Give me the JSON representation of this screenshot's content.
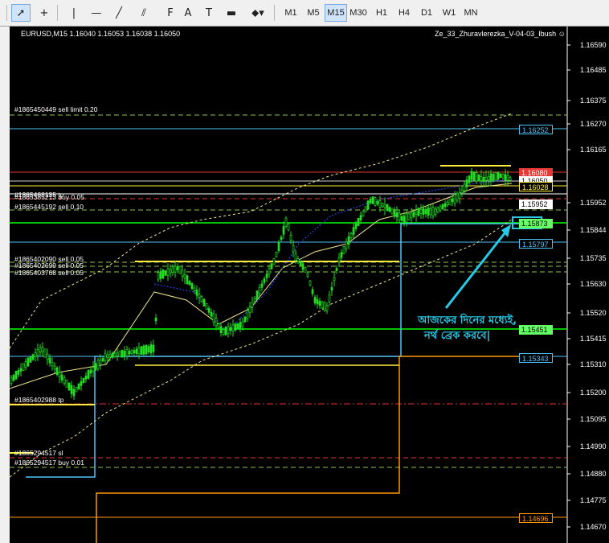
{
  "toolbar": {
    "tools": [
      {
        "name": "cursor-arrow-icon",
        "glyph": "➚"
      },
      {
        "name": "crosshair-icon",
        "glyph": "+"
      },
      {
        "name": "vertical-line-icon",
        "glyph": "|"
      },
      {
        "name": "horizontal-line-icon",
        "glyph": "—"
      },
      {
        "name": "trendline-icon",
        "glyph": "╱"
      },
      {
        "name": "channel-icon",
        "glyph": "⫽"
      },
      {
        "name": "fibonacci-icon",
        "glyph": "F"
      },
      {
        "name": "text-icon",
        "glyph": "A"
      },
      {
        "name": "text-label-icon",
        "glyph": "T"
      },
      {
        "name": "rectangle-icon",
        "glyph": "▬"
      },
      {
        "name": "arrows-dropdown-icon",
        "glyph": "⬥▾"
      }
    ],
    "timeframes": [
      "M1",
      "M5",
      "M15",
      "M30",
      "H1",
      "H4",
      "D1",
      "W1",
      "MN"
    ],
    "active_timeframe": "M15"
  },
  "chart": {
    "symbol_header": "EURUSD,M15  1.16040 1.16053 1.16038 1.16050",
    "expert_label": "Ze_33_Zhuravlerezka_V-04-03_Ibush",
    "smiley_icon": "☺",
    "price_ticks": [
      "1.16590",
      "1.16485",
      "1.16375",
      "1.16270",
      "1.16165",
      "1.15952",
      "1.15844",
      "1.15735",
      "1.15630",
      "1.15520",
      "1.15415",
      "1.15310",
      "1.15200",
      "1.15095",
      "1.14990",
      "1.14880",
      "1.14775",
      "1.14670"
    ],
    "level_boxes": [
      {
        "label": "1.16252",
        "color": "#4fc3f7",
        "border": "#4fc3f7"
      },
      {
        "label": "1.16080",
        "color": "#ffffff",
        "bg": "#e53935"
      },
      {
        "label": "1.16050",
        "color": "#000000",
        "bg": "#ffffff"
      },
      {
        "label": "1.16028",
        "color": "#ffeb3b",
        "border": "#ffeb3b"
      },
      {
        "label": "1.15952",
        "color": "#000000",
        "bg": "#ffffff"
      },
      {
        "label": "1.15873",
        "color": "#000000",
        "bg": "#66ff66"
      },
      {
        "label": "1.15797",
        "color": "#4fc3f7",
        "border": "#4fc3f7"
      },
      {
        "label": "1.15451",
        "color": "#000000",
        "bg": "#66ff66"
      },
      {
        "label": "1.15343",
        "color": "#4fc3f7",
        "border": "#4fc3f7"
      },
      {
        "label": "1.14696",
        "color": "#ff9800",
        "border": "#ff9800"
      }
    ],
    "order_labels": [
      "#1865450449 sell limit 0.20",
      "#1865468135 tp",
      "#1865385213 buy 0.05",
      "#1865445192 sell 0.10",
      "#1865402090 sell 0.05",
      "#1865402699 sell 0.05",
      "#1865403768 sell 0.05",
      "#1865402988 tp",
      "#1865294517 sl",
      "#1865294517 buy 0.01"
    ],
    "annotation_line1": "আজকের দিনের মধ্যেই,",
    "annotation_line2": "নর্থ ব্রেক করবে|"
  }
}
